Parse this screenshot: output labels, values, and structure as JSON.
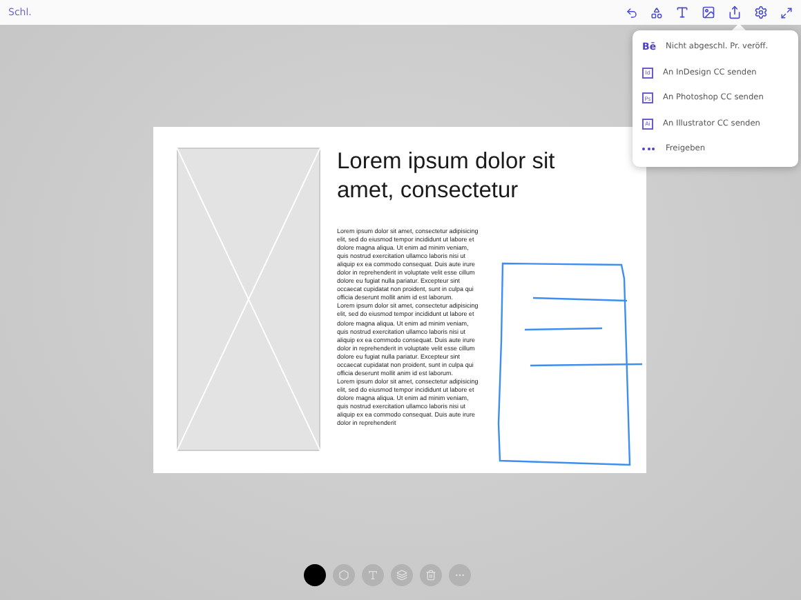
{
  "toolbar": {
    "back_link": "Schl."
  },
  "share_menu": {
    "items": [
      {
        "kind": "behance",
        "badge": "Bē",
        "label": "Nicht abgeschl. Pr. veröff."
      },
      {
        "kind": "app",
        "badge": "Id",
        "label": "An InDesign CC senden"
      },
      {
        "kind": "app",
        "badge": "Ps",
        "label": "An Photoshop CC senden"
      },
      {
        "kind": "app",
        "badge": "Ai",
        "label": "An Illustrator CC senden"
      },
      {
        "kind": "more",
        "label": "Freigeben"
      }
    ]
  },
  "layout": {
    "title": "Lorem ipsum dolor sit amet, consectetur",
    "paragraphs": [
      "Lorem ipsum dolor sit amet, consectetur adipisicing elit, sed do eiusmod tempor incididunt ut labore et dolore magna aliqua. Ut enim ad minim veniam, quis nostrud exercitation ullamco laboris nisi ut aliquip ex ea commodo consequat. Duis aute irure dolor in reprehenderit in voluptate velit esse cillum dolore eu fugiat nulla pariatur. Excepteur sint occaecat cupidatat non proident, sunt in culpa qui officia deserunt mollit anim id est laborum.",
      "Lorem ipsum dolor sit amet, consectetur adipisicing elit, sed do eiusmod tempor incididunt ut labore et dolore magna aliqua. Ut enim ad minim veniam, quis nostrud exercitation ullamco laboris nisi ut aliquip ex ea commodo consequat. Duis aute irure dolor in reprehenderit in voluptate velit esse cillum dolore eu fugiat nulla pariatur. Excepteur sint occaecat cupidatat non proident, sunt in culpa qui officia deserunt mollit anim id est laborum.",
      "Lorem ipsum dolor sit amet, consectetur adipisicing elit, sed do eiusmod tempor incididunt ut labore et dolore magna aliqua. Ut enim ad minim veniam, quis nostrud exercitation ullamco laboris nisi ut aliquip ex ea commodo consequat. Duis aute irure dolor in reprehenderit"
    ]
  },
  "bottom_tools": [
    {
      "kind": "color",
      "color": "#000000"
    },
    {
      "kind": "shape"
    },
    {
      "kind": "text"
    },
    {
      "kind": "layers"
    },
    {
      "kind": "delete"
    },
    {
      "kind": "more"
    }
  ]
}
